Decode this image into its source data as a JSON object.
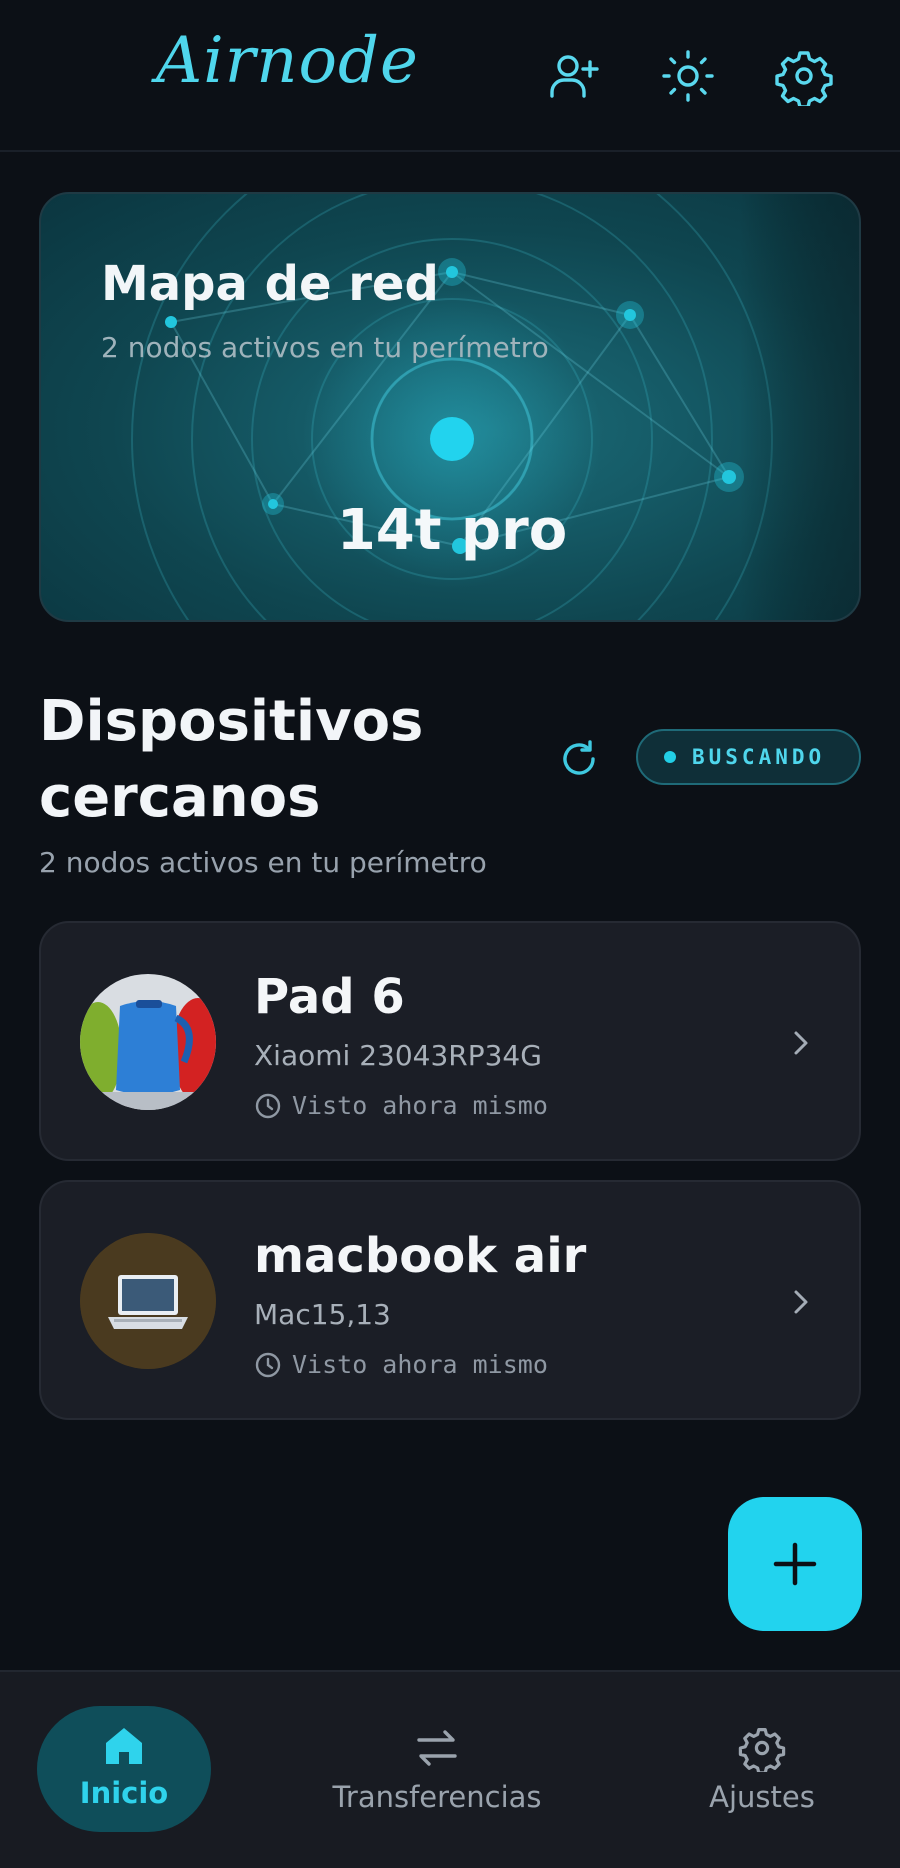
{
  "app": {
    "name": "Airnode"
  },
  "header": {
    "icons": [
      "add-user-icon",
      "sun-icon",
      "gear-icon"
    ]
  },
  "map": {
    "title": "Mapa de red",
    "subtitle": "2 nodos activos en tu perímetro",
    "device_name": "14t pro"
  },
  "nearby": {
    "title": "Dispositivos cercanos",
    "subtitle": "2 nodos activos en tu perímetro",
    "status": "BUSCANDO"
  },
  "devices": [
    {
      "name": "Pad 6",
      "model": "Xiaomi 23043RP34G",
      "seen": "Visto ahora mismo",
      "avatar": "kettles-photo"
    },
    {
      "name": "macbook air",
      "model": "Mac15,13",
      "seen": "Visto ahora mismo",
      "avatar": "laptop-emoji"
    }
  ],
  "fab": {
    "icon": "plus-icon"
  },
  "nav": {
    "items": [
      {
        "label": "Inicio",
        "icon": "home-icon",
        "active": true
      },
      {
        "label": "Transferencias",
        "icon": "transfer-icon",
        "active": false
      },
      {
        "label": "Ajustes",
        "icon": "gear-icon",
        "active": false
      }
    ]
  },
  "colors": {
    "accent": "#22d3ee",
    "background": "#0c1016",
    "card": "#1b1e26"
  }
}
